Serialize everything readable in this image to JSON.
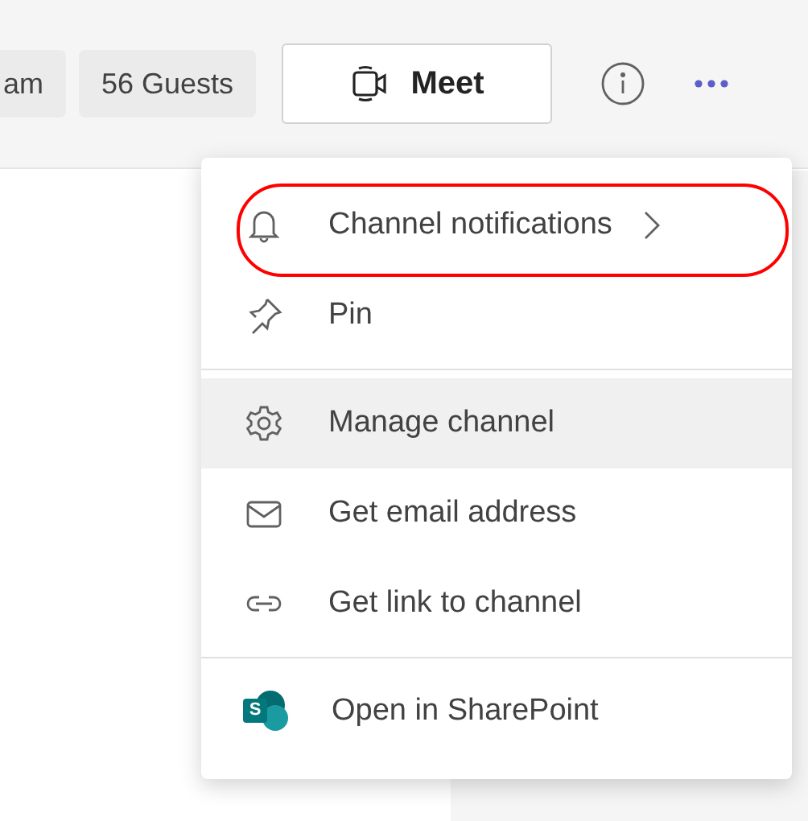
{
  "header": {
    "chips": [
      {
        "label": "am"
      },
      {
        "label": "56 Guests"
      }
    ],
    "meet_button": {
      "label": "Meet"
    }
  },
  "menu": {
    "groups": [
      {
        "items": [
          {
            "kind": "bell",
            "label": "Channel notifications",
            "has_submenu": true,
            "selected": false,
            "circled": true
          },
          {
            "kind": "pin",
            "label": "Pin",
            "has_submenu": false,
            "selected": false,
            "circled": false
          }
        ]
      },
      {
        "items": [
          {
            "kind": "gear",
            "label": "Manage channel",
            "has_submenu": false,
            "selected": true,
            "circled": false
          },
          {
            "kind": "mail",
            "label": "Get email address",
            "has_submenu": false,
            "selected": false,
            "circled": false
          },
          {
            "kind": "link",
            "label": "Get link to channel",
            "has_submenu": false,
            "selected": false,
            "circled": false
          }
        ]
      },
      {
        "items": [
          {
            "kind": "sharepoint",
            "logo_letter": "S",
            "label": "Open in SharePoint",
            "has_submenu": false,
            "selected": false,
            "circled": false
          }
        ]
      }
    ]
  }
}
